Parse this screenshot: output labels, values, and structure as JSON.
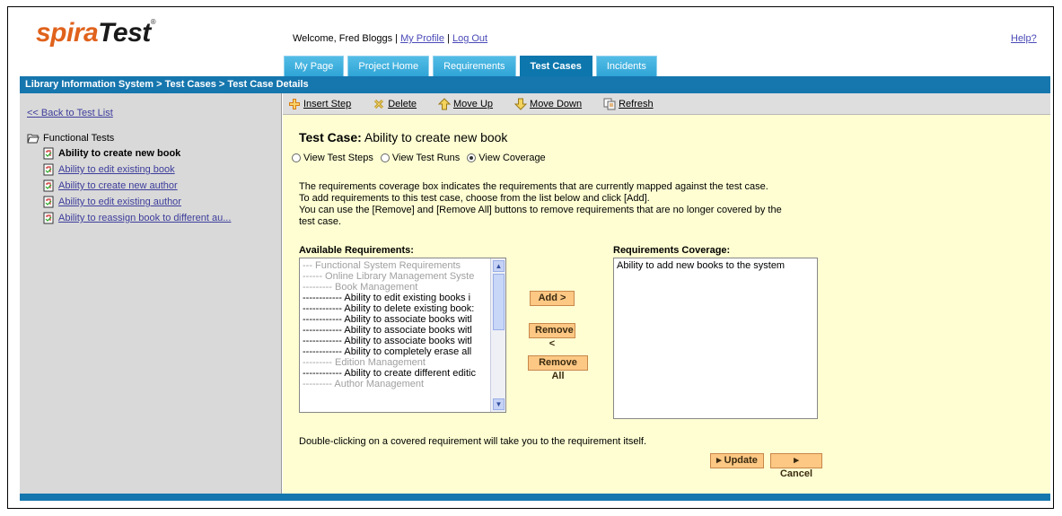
{
  "app": {
    "logo_part1": "spira",
    "logo_part2": "Test",
    "logo_tm": "®"
  },
  "header": {
    "welcome": "Welcome, Fred Bloggs",
    "sep1": "|",
    "my_profile": "My Profile",
    "sep2": "|",
    "log_out": "Log Out",
    "help": "Help?"
  },
  "tabs": [
    {
      "label": "My Page"
    },
    {
      "label": "Project Home"
    },
    {
      "label": "Requirements"
    },
    {
      "label": "Test Cases",
      "active": true
    },
    {
      "label": "Incidents"
    }
  ],
  "breadcrumb": "Library Information System > Test Cases > Test Case Details",
  "sidebar": {
    "back_link": "<< Back to Test List",
    "folder": "Functional Tests",
    "items": [
      {
        "label": "Ability to create new book"
      },
      {
        "label": "Ability to edit existing book"
      },
      {
        "label": "Ability to create new author"
      },
      {
        "label": "Ability to edit existing author"
      },
      {
        "label": "Ability to reassign book to different au..."
      }
    ]
  },
  "toolbar": {
    "insert_step": "Insert Step",
    "delete": "Delete",
    "move_up": "Move Up",
    "move_down": "Move Down",
    "refresh": "Refresh"
  },
  "testcase": {
    "prefix": "Test Case:",
    "name": "Ability to create new book"
  },
  "views": {
    "steps": "View Test Steps",
    "runs": "View Test Runs",
    "coverage": "View Coverage",
    "selected": "coverage"
  },
  "description": [
    "The requirements coverage box indicates the requirements that are currently mapped against the test case.",
    "To add requirements to this test case, choose from the list below and click [Add].",
    "You can use the [Remove] and [Remove All] buttons to remove requirements that are no longer covered by the",
    "test case."
  ],
  "available": {
    "label": "Available Requirements:",
    "items": [
      {
        "text": "--- Functional System Requirements",
        "grey": true
      },
      {
        "text": "------ Online Library Management Syste",
        "grey": true
      },
      {
        "text": "--------- Book Management",
        "grey": true
      },
      {
        "text": "------------ Ability to edit existing books i",
        "grey": false
      },
      {
        "text": "------------ Ability to delete existing book:",
        "grey": false
      },
      {
        "text": "------------ Ability to associate books witl",
        "grey": false
      },
      {
        "text": "------------ Ability to associate books witl",
        "grey": false
      },
      {
        "text": "------------ Ability to associate books witl",
        "grey": false
      },
      {
        "text": "------------ Ability to completely erase all",
        "grey": false
      },
      {
        "text": "--------- Edition Management",
        "grey": true
      },
      {
        "text": "------------ Ability to create different editic",
        "grey": false
      },
      {
        "text": "--------- Author Management",
        "grey": true
      }
    ]
  },
  "coverage": {
    "label": "Requirements Coverage:",
    "items": [
      "Ability to add new books to the system"
    ]
  },
  "buttons": {
    "add": "Add >",
    "remove": "Remove <",
    "remove_all": "Remove All",
    "update": "▸ Update",
    "cancel": "▸ Cancel"
  },
  "note": "Double-clicking on a covered requirement will take you to the requirement itself.",
  "colors": {
    "accent_blue": "#1676ae",
    "tab_blue": "#2fa4d6",
    "panel_yellow": "#fefed2",
    "button_orange": "#fcc884"
  }
}
